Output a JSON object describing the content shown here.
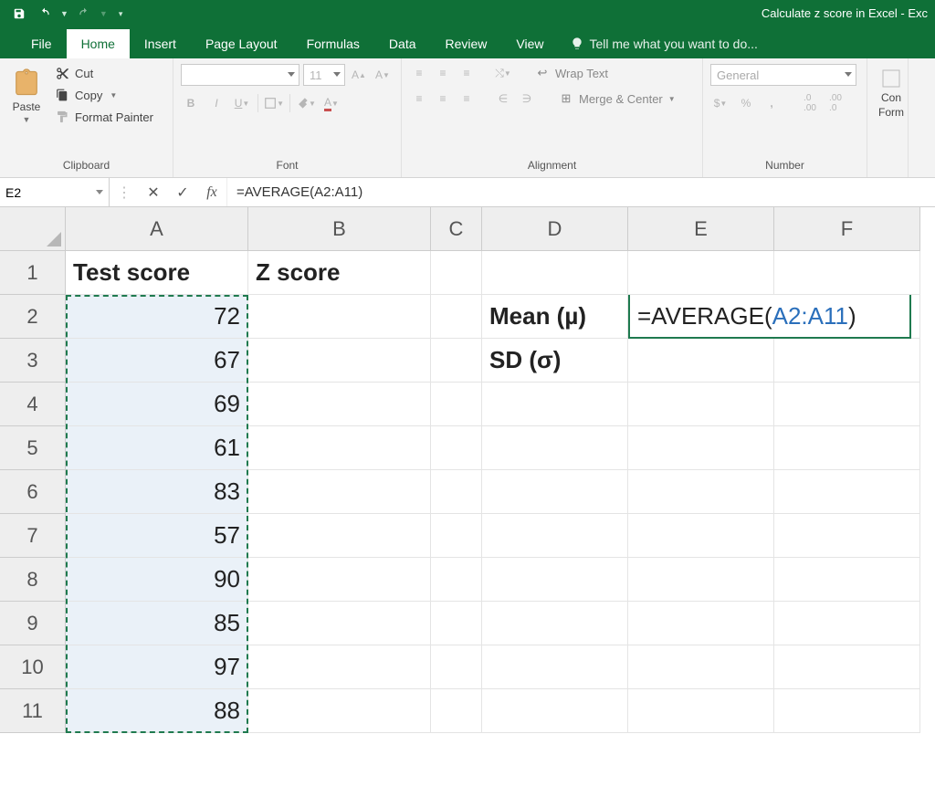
{
  "app": {
    "title": "Calculate z score in Excel - Exc"
  },
  "qat": {
    "save": "save-icon",
    "undo": "undo-icon",
    "redo": "redo-icon"
  },
  "tabs": {
    "file": "File",
    "home": "Home",
    "insert": "Insert",
    "pagelayout": "Page Layout",
    "formulas": "Formulas",
    "data": "Data",
    "review": "Review",
    "view": "View",
    "tellme": "Tell me what you want to do..."
  },
  "ribbon": {
    "clipboard": {
      "paste": "Paste",
      "cut": "Cut",
      "copy": "Copy",
      "formatpainter": "Format Painter",
      "label": "Clipboard"
    },
    "font": {
      "family": "",
      "size": "11",
      "label": "Font"
    },
    "alignment": {
      "wrap": "Wrap Text",
      "merge": "Merge & Center",
      "label": "Alignment"
    },
    "number": {
      "format": "General",
      "label": "Number"
    },
    "styles": {
      "cond": "Con",
      "cond2": "Form"
    }
  },
  "namebox": {
    "value": "E2"
  },
  "formula": {
    "text": "=AVERAGE(A2:A11)"
  },
  "columns": [
    "A",
    "B",
    "C",
    "D",
    "E",
    "F"
  ],
  "rows": [
    "1",
    "2",
    "3",
    "4",
    "5",
    "6",
    "7",
    "8",
    "9",
    "10",
    "11"
  ],
  "headers": {
    "A1": "Test score",
    "B1": "Z score",
    "D2": "Mean (µ)",
    "D3": "SD (σ)"
  },
  "scores": [
    "72",
    "67",
    "69",
    "61",
    "83",
    "57",
    "90",
    "85",
    "97",
    "88"
  ],
  "edit": {
    "prefix": "=AVERAGE(",
    "range": "A2:A11",
    "suffix": ")"
  }
}
